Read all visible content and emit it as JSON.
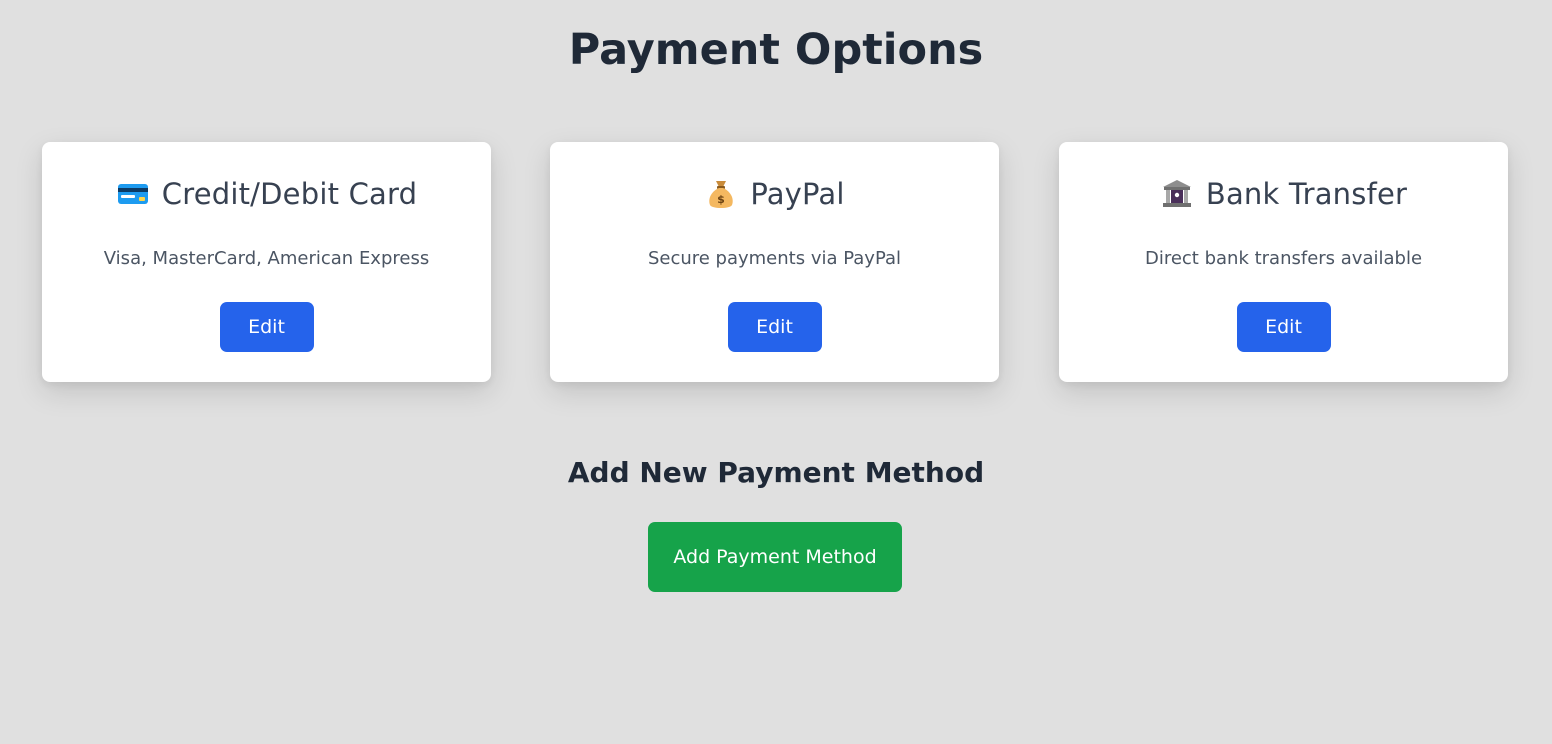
{
  "page": {
    "title": "Payment Options"
  },
  "methods": [
    {
      "icon": "credit-card-icon",
      "title": "Credit/Debit Card",
      "description": "Visa, MasterCard, American Express",
      "button_label": "Edit"
    },
    {
      "icon": "money-bag-icon",
      "title": "PayPal",
      "description": "Secure payments via PayPal",
      "button_label": "Edit"
    },
    {
      "icon": "bank-icon",
      "title": "Bank Transfer",
      "description": "Direct bank transfers available",
      "button_label": "Edit"
    }
  ],
  "add_section": {
    "heading": "Add New Payment Method",
    "button_label": "Add Payment Method"
  },
  "colors": {
    "background": "#e0e0e0",
    "edit_button": "#2563eb",
    "add_button": "#16a34a",
    "heading_text": "#1f2937"
  }
}
